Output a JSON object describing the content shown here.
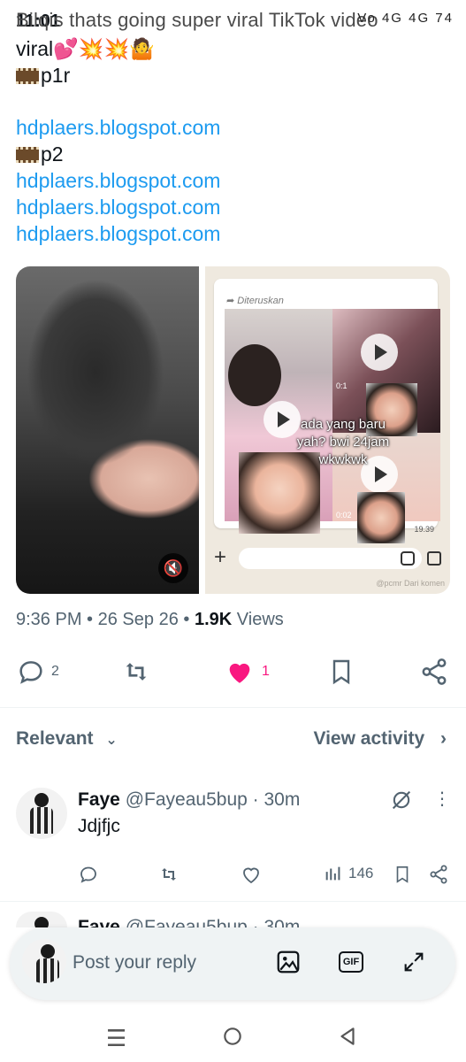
{
  "status_bar": {
    "time": "11:01",
    "overlay_title": "Bilqis thats going super viral TikTok video",
    "icons_text": "Vo 4G 4G 74"
  },
  "tweet": {
    "line1": "viral💕💥💥🤷",
    "line2": "p1r",
    "link1": "hdplaers.blogspot.com",
    "line3": "p2",
    "link2": "hdplaers.blogspot.com",
    "link3": "hdplaers.blogspot.com",
    "link4": "hdplaers.blogspot.com",
    "media": {
      "forwarded_label": "Diteruskan",
      "overlay_text": "ada yang baru yah? bwi 24jam wkwkwk",
      "timestamp": "19.39",
      "watermark": "@pcmr Dari komen",
      "small_time_a": "0:1",
      "small_time_b": "0:02"
    },
    "meta": {
      "time": "9:36 PM",
      "sep": "•",
      "date": "26 Sep 26",
      "views_count": "1.9K",
      "views_label": "Views"
    },
    "actions": {
      "replies": "2",
      "likes": "1"
    }
  },
  "filter": {
    "relevant_label": "Relevant",
    "view_activity_label": "View activity"
  },
  "replies": [
    {
      "name": "Faye",
      "handle": "@Fayeau5bup",
      "age": "30m",
      "text": "Jdjfjc",
      "views": "146"
    },
    {
      "name": "Faye",
      "handle": "@Fayeau5bup",
      "age": "30m"
    }
  ],
  "composer": {
    "placeholder": "Post your reply",
    "gif_label": "GIF"
  },
  "colors": {
    "link": "#1d9bf0",
    "like": "#f91880",
    "muted": "#536471"
  }
}
